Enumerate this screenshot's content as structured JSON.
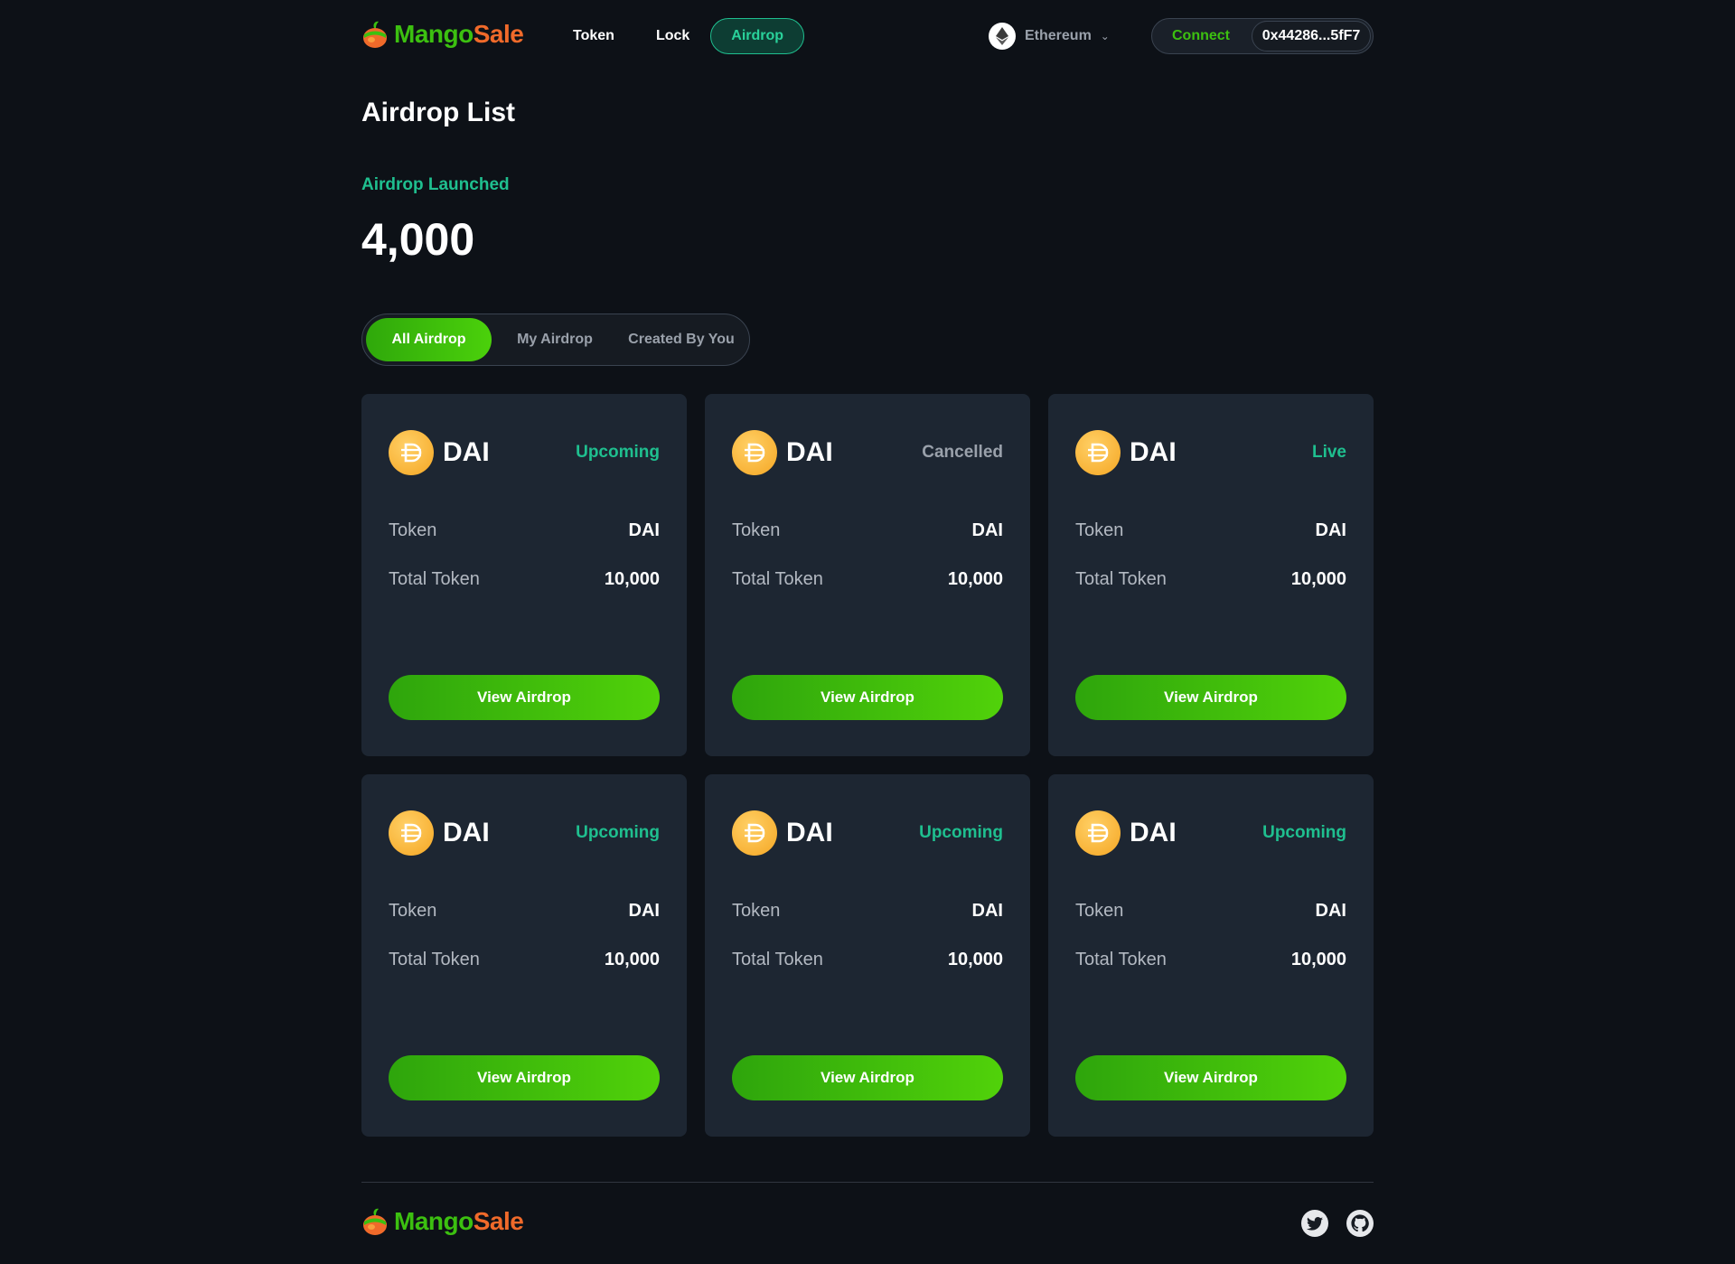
{
  "brand": {
    "name_part1": "Mango",
    "name_part2": "Sale"
  },
  "nav": {
    "items": [
      {
        "label": "Token",
        "active": false
      },
      {
        "label": "Lock",
        "active": false
      },
      {
        "label": "Airdrop",
        "active": true
      }
    ]
  },
  "network": {
    "label": "Ethereum",
    "icon": "ethereum-icon"
  },
  "wallet": {
    "connect_label": "Connect",
    "address": "0x44286...5fF7"
  },
  "page": {
    "title": "Airdrop List"
  },
  "stat": {
    "label": "Airdrop Launched",
    "value": "4,000"
  },
  "tabs": [
    {
      "label": "All Airdrop",
      "active": true
    },
    {
      "label": "My Airdrop",
      "active": false
    },
    {
      "label": "Created By You",
      "active": false
    }
  ],
  "cards": [
    {
      "symbol": "DAI",
      "status": "Upcoming",
      "token_label": "Token",
      "token": "DAI",
      "total_label": "Total Token",
      "total": "10,000",
      "button": "View Airdrop"
    },
    {
      "symbol": "DAI",
      "status": "Cancelled",
      "token_label": "Token",
      "token": "DAI",
      "total_label": "Total Token",
      "total": "10,000",
      "button": "View Airdrop"
    },
    {
      "symbol": "DAI",
      "status": "Live",
      "token_label": "Token",
      "token": "DAI",
      "total_label": "Total Token",
      "total": "10,000",
      "button": "View Airdrop"
    },
    {
      "symbol": "DAI",
      "status": "Upcoming",
      "token_label": "Token",
      "token": "DAI",
      "total_label": "Total Token",
      "total": "10,000",
      "button": "View Airdrop"
    },
    {
      "symbol": "DAI",
      "status": "Upcoming",
      "token_label": "Token",
      "token": "DAI",
      "total_label": "Total Token",
      "total": "10,000",
      "button": "View Airdrop"
    },
    {
      "symbol": "DAI",
      "status": "Upcoming",
      "token_label": "Token",
      "token": "DAI",
      "total_label": "Total Token",
      "total": "10,000",
      "button": "View Airdrop"
    }
  ],
  "footer": {
    "social": [
      "twitter-icon",
      "github-icon"
    ]
  },
  "colors": {
    "accent_green": "#3cc010",
    "accent_teal": "#1fbf8f",
    "brand_orange": "#f06a2a",
    "card_bg": "#1d2632",
    "page_bg": "#0d1117"
  }
}
